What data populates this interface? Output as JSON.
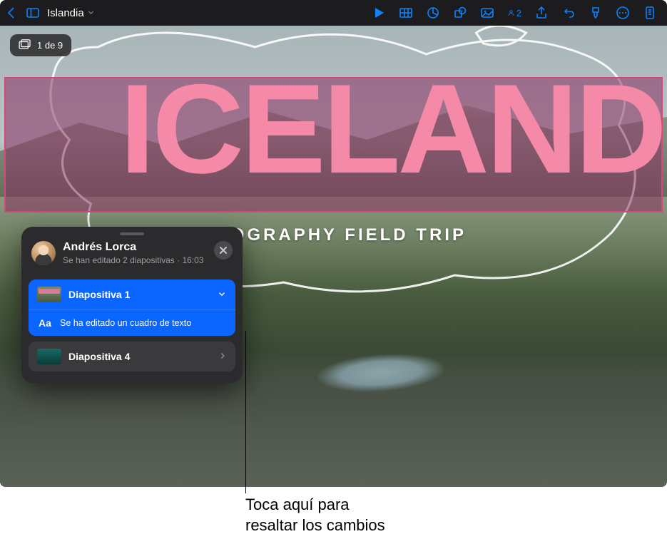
{
  "toolbar": {
    "doc_title": "Islandia",
    "collab_count": "2"
  },
  "slide_counter": "1 de 9",
  "slide": {
    "title": "ICELAND",
    "subtitle": "GEOGRAPHY FIELD TRIP"
  },
  "popover": {
    "user_name": "Andrés Lorca",
    "summary": "Se han editado 2 diapositivas",
    "time": "16:03",
    "items": [
      {
        "label": "Diapositiva 1",
        "expanded": true,
        "details": [
          "Se ha editado un cuadro de texto"
        ]
      },
      {
        "label": "Diapositiva 4",
        "expanded": false
      }
    ]
  },
  "callout": {
    "line1": "Toca aquí para",
    "line2": "resaltar los cambios"
  }
}
